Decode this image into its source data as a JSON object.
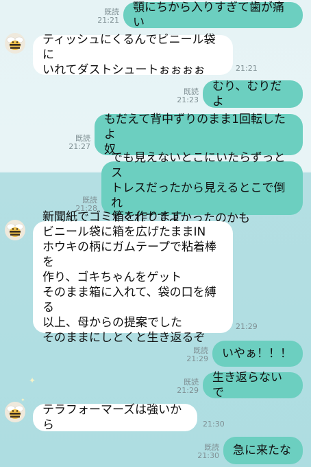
{
  "read_label": "既読",
  "messages": [
    {
      "side": "out",
      "text": "顎にちから入りすぎて歯が痛い",
      "time": "21:21",
      "read": true
    },
    {
      "side": "in",
      "text": "ティッシュにくるんでビニール袋に\nいれてダストシュートぉぉぉぉ",
      "time": "21:21"
    },
    {
      "side": "out",
      "text": "むり、むりだよ",
      "time": "21:23",
      "read": true
    },
    {
      "side": "out",
      "text": "もだえて背中ずりのまま1回転したよ\n奴",
      "time": "21:27",
      "read": true
    },
    {
      "side": "out",
      "text": "でも見えないとこにいたらずっとス\nトレスだったから見えるとこで倒れ\nてくれててよかったのかも",
      "time": "21:28",
      "read": true
    },
    {
      "side": "in",
      "text": "新聞紙でゴミ箱を作ります\nビニール袋に箱を広げたままIN\nホウキの柄にガムテープで粘着棒を\n作り、ゴキちゃんをゲット\nそのまま箱に入れて、袋の口を縛る\n以上、母からの提案でした\nそのままにしとくと生き返るぞ",
      "time": "21:29"
    },
    {
      "side": "out",
      "text": "いやぁ！！！",
      "time": "21:29",
      "read": true
    },
    {
      "side": "out",
      "text": "生き返らないで",
      "time": "21:29",
      "read": true
    },
    {
      "side": "in",
      "text": "テラフォーマーズは強いから",
      "time": "21:30"
    },
    {
      "side": "out",
      "text": "急に来たな",
      "time": "21:30",
      "read": true
    }
  ],
  "icons": {
    "avatar": "bee-avatar-icon",
    "star": "star-icon"
  },
  "colors": {
    "outgoing": "#6ccfc0",
    "incoming": "#ffffff",
    "background_top": "#e6f3f5",
    "background_bottom": "#aedde1"
  }
}
